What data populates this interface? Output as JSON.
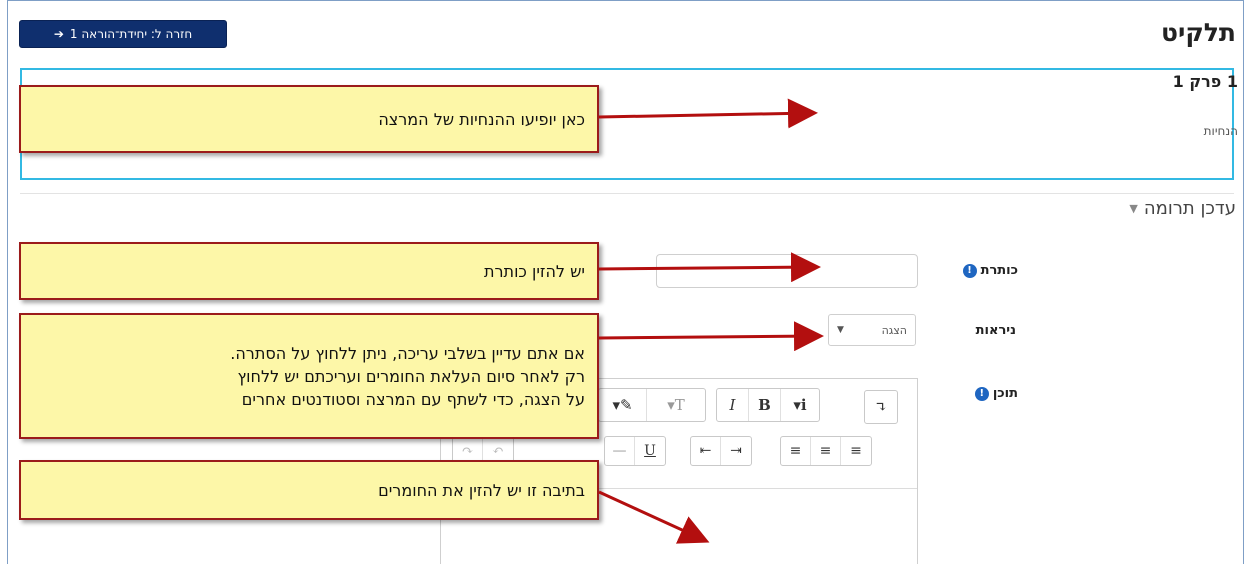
{
  "header": {
    "back_button_label": "חזרה ל: יחידת־הוראה 1",
    "page_title": "תלקיט"
  },
  "chapter": {
    "title": "1 פרק 1",
    "instructions": "הנחיות"
  },
  "section": {
    "title": "עדכן תרומה"
  },
  "form": {
    "title_label": "כותרת",
    "visibility_label": "ניראות",
    "visibility_value": "הצגה",
    "content_label": "תוכן"
  },
  "editor_toolbar": {
    "row1": [
      "↴",
      "i",
      "B",
      "I",
      "T",
      "✎",
      "▾"
    ],
    "row2": [
      "≡",
      "≡",
      "≡",
      "⇤",
      "⇥",
      "U",
      "—",
      "I",
      "↶",
      "↷"
    ]
  },
  "callouts": {
    "instructions_note": "כאן יופיעו ההנחיות של המרצה",
    "title_note": "יש להזין כותרת",
    "visibility_note_line1": "אם אתם עדיין בשלבי עריכה, ניתן ללחוץ על הסתרה.",
    "visibility_note_line2": "רק לאחר סיום העלאת החומרים ועריכתם יש  ללחוץ",
    "visibility_note_line3": "על הצגה, כדי לשתף עם המרצה וסטודנטים אחרים",
    "content_note": "בתיבה זו יש להזין את החומרים"
  },
  "colors": {
    "back_button_bg": "#0f2f6e",
    "chapter_border": "#32b9e3",
    "callout_bg": "#fdf7a8",
    "callout_border": "#9b1b1b",
    "info_icon": "#1f66c1"
  }
}
